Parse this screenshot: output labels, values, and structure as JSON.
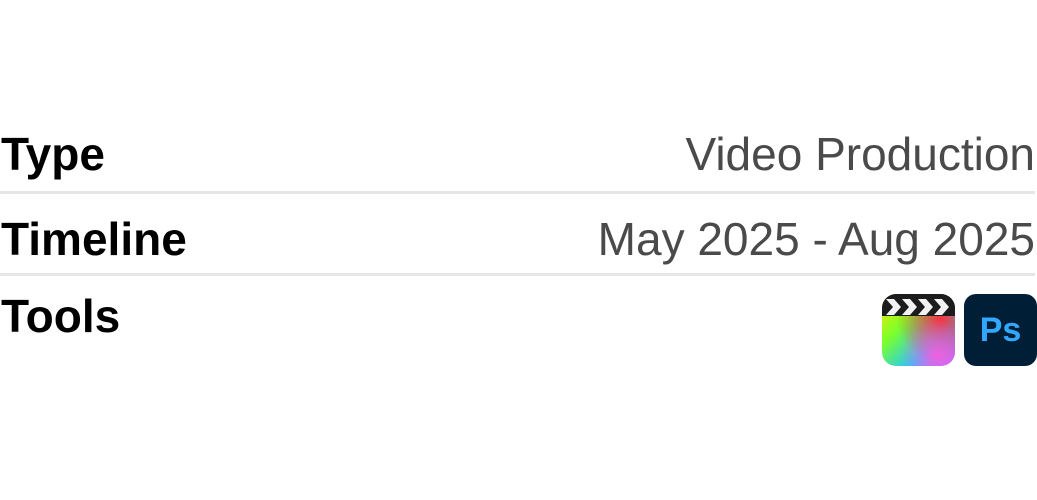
{
  "rows": [
    {
      "label": "Type",
      "value": "Video Production"
    },
    {
      "label": "Timeline",
      "value": "May 2025 - Aug 2025"
    },
    {
      "label": "Tools",
      "icons": [
        "final-cut-pro-icon",
        "photoshop-icon"
      ]
    }
  ],
  "photoshop": {
    "text": "Ps",
    "bg": "#001e36",
    "fg": "#31a8ff"
  },
  "colors": {
    "label": "#000000",
    "value": "#4a4a4a",
    "divider": "#e6e6e6"
  }
}
